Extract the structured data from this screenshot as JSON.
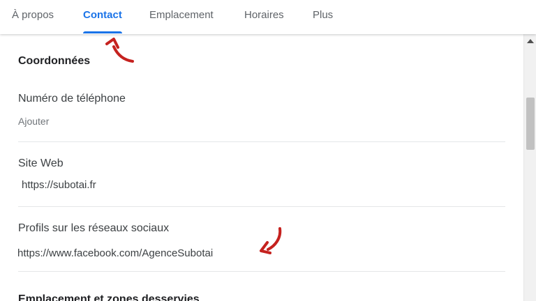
{
  "tabs": [
    {
      "label": "À propos",
      "active": false
    },
    {
      "label": "Contact",
      "active": true
    },
    {
      "label": "Emplacement",
      "active": false
    },
    {
      "label": "Horaires",
      "active": false
    },
    {
      "label": "Plus",
      "active": false
    }
  ],
  "section": {
    "heading": "Coordonnées",
    "phone": {
      "label": "Numéro de téléphone",
      "value": "Ajouter"
    },
    "website": {
      "label": "Site Web",
      "value": "https://subotai.fr"
    },
    "social": {
      "label": "Profils sur les réseaux sociaux",
      "value": "https://www.facebook.com/AgenceSubotai"
    }
  },
  "next_section": {
    "heading": "Emplacement et zones desservies"
  },
  "colors": {
    "accent": "#1a73e8",
    "annotation_arrow": "#c5221f"
  }
}
